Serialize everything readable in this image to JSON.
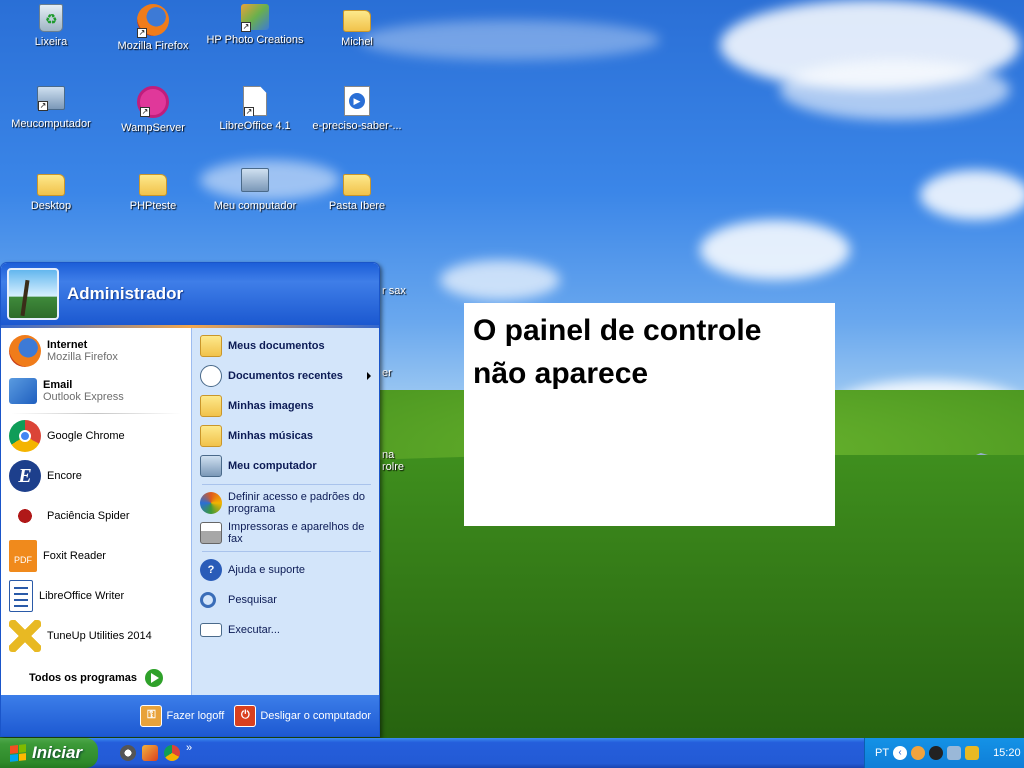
{
  "desktop_icons": [
    {
      "label": "Lixeira",
      "icon": "recycle-bin-icon"
    },
    {
      "label": "Mozilla Firefox",
      "icon": "firefox-icon"
    },
    {
      "label": "HP Photo Creations",
      "icon": "photo-creations-icon"
    },
    {
      "label": "Michel",
      "icon": "folder-icon"
    },
    {
      "label": "Meucomputador",
      "icon": "computer-icon"
    },
    {
      "label": "WampServer",
      "icon": "wampserver-icon"
    },
    {
      "label": "LibreOffice 4.1",
      "icon": "document-icon"
    },
    {
      "label": "e-preciso-saber-...",
      "icon": "media-file-icon"
    },
    {
      "label": "Desktop",
      "icon": "folder-icon"
    },
    {
      "label": "PHPteste",
      "icon": "folder-icon"
    },
    {
      "label": "Meu computador",
      "icon": "computer-icon"
    },
    {
      "label": "Pasta Ibere",
      "icon": "folder-icon"
    }
  ],
  "partial_labels": {
    "a": "r sax",
    "b": "er",
    "c": "na",
    "d": "rolre"
  },
  "start_menu": {
    "user": "Administrador",
    "pinned": [
      {
        "title": "Internet",
        "subtitle": "Mozilla Firefox",
        "icon": "firefox-icon"
      },
      {
        "title": "Email",
        "subtitle": "Outlook Express",
        "icon": "outlook-express-icon"
      }
    ],
    "recent": [
      {
        "label": "Google Chrome",
        "icon": "chrome-icon"
      },
      {
        "label": "Encore",
        "icon": "encore-icon"
      },
      {
        "label": "Paciência Spider",
        "icon": "spider-solitaire-icon"
      },
      {
        "label": "Foxit Reader",
        "icon": "foxit-reader-icon"
      },
      {
        "label": "LibreOffice Writer",
        "icon": "libreoffice-writer-icon"
      },
      {
        "label": "TuneUp Utilities 2014",
        "icon": "tuneup-icon"
      }
    ],
    "all_programs": "Todos os programas",
    "right_bold": [
      {
        "label": "Meus documentos",
        "icon": "my-documents-icon"
      },
      {
        "label": "Documentos recentes",
        "icon": "recent-documents-icon"
      },
      {
        "label": "Minhas imagens",
        "icon": "my-pictures-icon"
      },
      {
        "label": "Minhas músicas",
        "icon": "my-music-icon"
      },
      {
        "label": "Meu computador",
        "icon": "my-computer-icon"
      }
    ],
    "right_mid": [
      {
        "label": "Definir acesso e padrões do programa",
        "icon": "program-defaults-icon"
      },
      {
        "label": "Impressoras e aparelhos de fax",
        "icon": "printer-icon"
      }
    ],
    "right_bottom": [
      {
        "label": "Ajuda e suporte",
        "icon": "help-icon"
      },
      {
        "label": "Pesquisar",
        "icon": "search-icon"
      },
      {
        "label": "Executar...",
        "icon": "run-icon"
      }
    ],
    "logoff": "Fazer logoff",
    "shutdown": "Desligar o computador"
  },
  "taskbar": {
    "start_label": "Iniciar",
    "quick_launch": [
      "show-desktop-icon",
      "paint-icon",
      "chrome-icon"
    ],
    "overflow": "»",
    "language": "PT",
    "clock": "15:20"
  },
  "note": {
    "line1": "O painel de controle",
    "line2": "não aparece"
  }
}
